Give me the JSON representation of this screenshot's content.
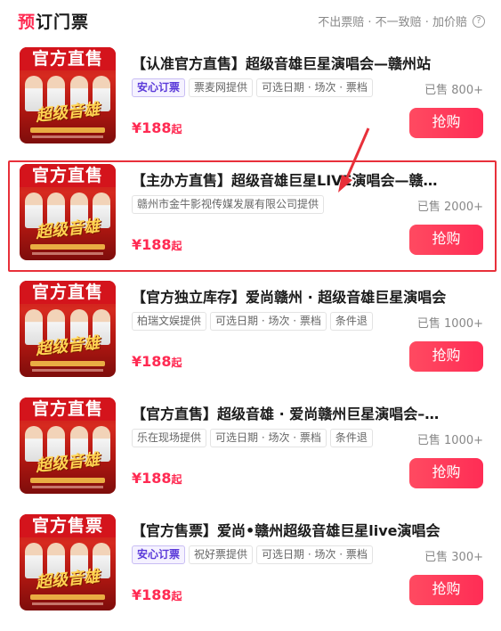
{
  "header": {
    "title_first": "预",
    "title_rest": "订门票",
    "guarantee": "不出票赔 · 不一致赔 · 加价赔"
  },
  "items": [
    {
      "poster_banner": "官方直售",
      "poster_logo": "超级音雄",
      "title": "【认准官方直售】超级音雄巨星演唱会—赣州站",
      "tags": [
        "安心订票",
        "票麦网提供",
        "可选日期 · 场次 · 票档"
      ],
      "sold": "已售 800+",
      "price": "¥188",
      "price_suffix": "起",
      "buy": "抢购"
    },
    {
      "poster_banner": "官方直售",
      "poster_logo": "超级音雄",
      "title": "【主办方直售】超级音雄巨星LIVE演唱会—赣…",
      "tags": [
        "赣州市金牛影视传媒发展有限公司提供"
      ],
      "sold": "已售 2000+",
      "price": "¥188",
      "price_suffix": "起",
      "buy": "抢购"
    },
    {
      "poster_banner": "官方直售",
      "poster_logo": "超级音雄",
      "title": "【官方独立库存】爱尚赣州 · 超级音雄巨星演唱会",
      "tags": [
        "柏瑞文娱提供",
        "可选日期 · 场次 · 票档",
        "条件退"
      ],
      "sold": "已售 1000+",
      "price": "¥188",
      "price_suffix": "起",
      "buy": "抢购"
    },
    {
      "poster_banner": "官方直售",
      "poster_logo": "超级音雄",
      "title": "【官方直售】超级音雄 · 爱尚赣州巨星演唱会–…",
      "tags": [
        "乐在现场提供",
        "可选日期 · 场次 · 票档",
        "条件退"
      ],
      "sold": "已售 1000+",
      "price": "¥188",
      "price_suffix": "起",
      "buy": "抢购"
    },
    {
      "poster_banner": "官方售票",
      "poster_logo": "超级音雄",
      "title": "【官方售票】爱尚•赣州超级音雄巨星live演唱会",
      "tags": [
        "安心订票",
        "祝好票提供",
        "可选日期 · 场次 · 票档"
      ],
      "sold": "已售 300+",
      "price": "¥188",
      "price_suffix": "起",
      "buy": "抢购"
    }
  ],
  "colors": {
    "accent": "#ff2a52",
    "highlight_box": "#e8303a",
    "assure_tag": "#5b3ad9"
  }
}
